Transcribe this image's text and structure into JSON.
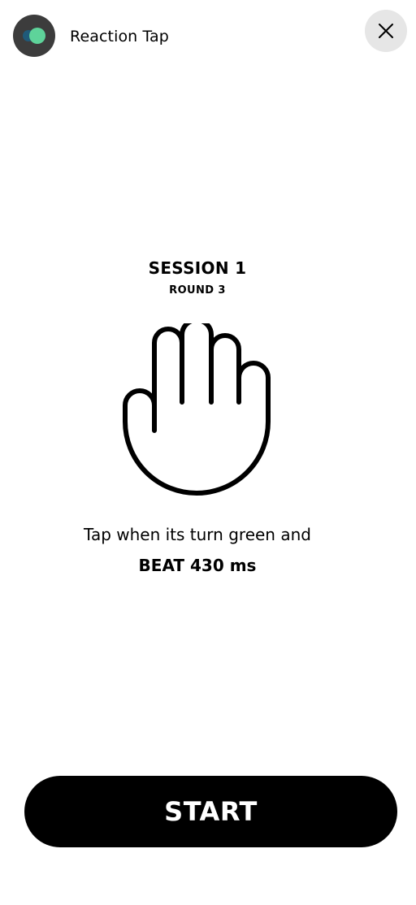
{
  "header": {
    "app_title": "Reaction Tap",
    "logo_icon": "app-logo-icon",
    "close_icon": "close-icon"
  },
  "main": {
    "session_title": "SESSION 1",
    "round_label": "ROUND 3",
    "hand_icon": "raised-hand-icon",
    "instruction": "Tap when its turn green and",
    "target": "BEAT 430 ms"
  },
  "footer": {
    "start_label": "START"
  },
  "colors": {
    "logo_background": "#3c3c3c",
    "logo_blue": "#1f5a7a",
    "logo_green": "#5ed39a",
    "close_button_background": "#e6e6e6",
    "primary_button": "#000000",
    "primary_button_text": "#ffffff"
  }
}
